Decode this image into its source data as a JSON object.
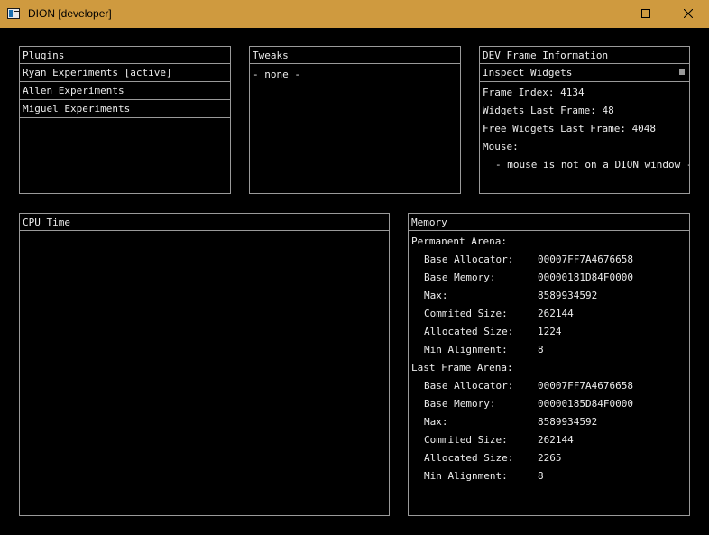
{
  "window": {
    "title": "DION [developer]",
    "controls": {
      "minimize_icon": "minimize-icon",
      "maximize_icon": "maximize-icon",
      "close_icon": "close-icon"
    },
    "titlebar_color": "#cf9a3f"
  },
  "plugins": {
    "header": "Plugins",
    "items": [
      "Ryan Experiments [active]",
      "Allen Experiments",
      "Miguel Experiments"
    ]
  },
  "tweaks": {
    "header": "Tweaks",
    "empty": "- none -"
  },
  "dev_frame": {
    "header": "DEV Frame Information",
    "inspect_label": "Inspect Widgets",
    "frame_index": "Frame Index: 4134",
    "widgets_last_frame": "Widgets Last Frame: 48",
    "free_widgets": "Free Widgets Last Frame: 4048",
    "mouse_label": "Mouse:",
    "mouse_status": "- mouse is not on a DION window -"
  },
  "cpu": {
    "header": "CPU Time"
  },
  "memory": {
    "header": "Memory",
    "permanent": {
      "title": "Permanent Arena:",
      "rows": [
        {
          "label": "Base Allocator:",
          "value": "00007FF7A4676658"
        },
        {
          "label": "Base Memory:",
          "value": "00000181D84F0000"
        },
        {
          "label": "Max:",
          "value": "8589934592"
        },
        {
          "label": "Commited Size:",
          "value": "262144"
        },
        {
          "label": "Allocated Size:",
          "value": "1224"
        },
        {
          "label": "Min Alignment:",
          "value": "8"
        }
      ]
    },
    "last_frame": {
      "title": "Last Frame Arena:",
      "rows": [
        {
          "label": "Base Allocator:",
          "value": "00007FF7A4676658"
        },
        {
          "label": "Base Memory:",
          "value": "00000185D84F0000"
        },
        {
          "label": "Max:",
          "value": "8589934592"
        },
        {
          "label": "Commited Size:",
          "value": "262144"
        },
        {
          "label": "Allocated Size:",
          "value": "2265"
        },
        {
          "label": "Min Alignment:",
          "value": "8"
        }
      ]
    }
  }
}
